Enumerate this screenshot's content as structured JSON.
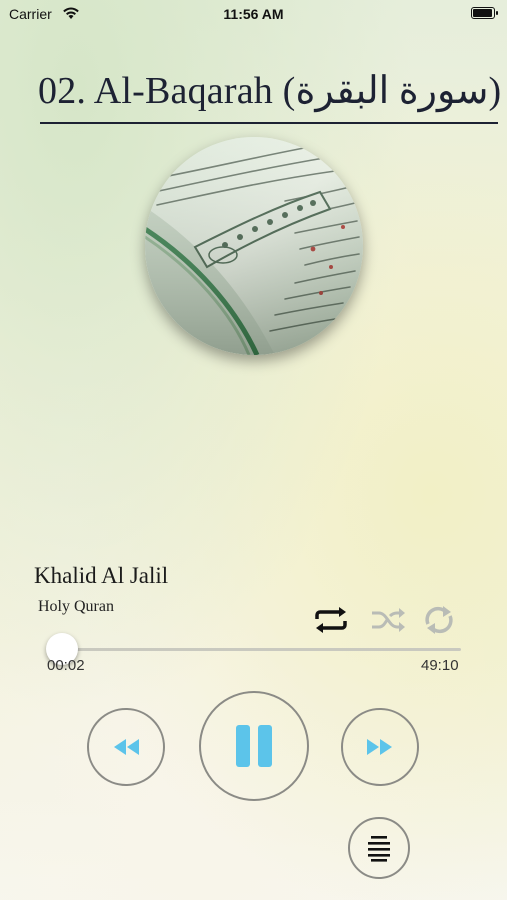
{
  "status_bar": {
    "carrier": "Carrier",
    "time": "11:56 AM",
    "battery_level": 0.9
  },
  "surah": {
    "title": "02. Al-Baqarah (سورة البقرة)"
  },
  "track": {
    "artist": "Khalid Al Jalil",
    "album": "Holy Quran",
    "elapsed": "00:02",
    "duration": "49:10",
    "progress": 0.001
  },
  "controls": {
    "repeat_all": {
      "icon": "repeat-icon",
      "active": true
    },
    "shuffle": {
      "icon": "shuffle-icon",
      "active": false
    },
    "repeat_one": {
      "icon": "repeat-one-icon",
      "active": false
    },
    "rewind": {
      "icon": "rewind-icon"
    },
    "play_pause": {
      "icon": "pause-icon"
    },
    "forward": {
      "icon": "fast-forward-icon"
    },
    "playlist": {
      "icon": "list-icon"
    }
  },
  "colors": {
    "accent": "#5cc4ea",
    "title": "#1d2233",
    "inactive": "#b9bcb6"
  }
}
